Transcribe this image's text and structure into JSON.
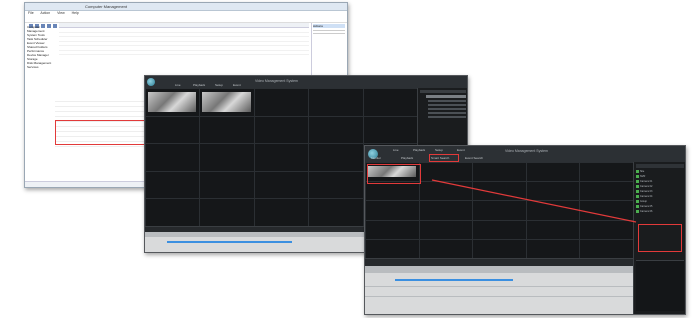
{
  "explorer": {
    "title": "Computer Management",
    "menu": [
      "File",
      "Action",
      "View",
      "Help"
    ],
    "tree_items": [
      "Computer Management",
      "System Tools",
      "Task Scheduler",
      "Event Viewer",
      "Shared Folders",
      "Performance",
      "Device Manager",
      "Storage",
      "Disk Management",
      "Services"
    ],
    "grid_rows": 12,
    "right_panel_title": "Actions"
  },
  "nvr_back": {
    "title": "Video Management System",
    "tabs": [
      "Live",
      "Playback",
      "Setup",
      "Event"
    ],
    "grid_cols": 5,
    "grid_rows": 5
  },
  "nvr_front": {
    "title": "Video Management System",
    "tabs": [
      "Live",
      "Playback",
      "Setup",
      "Event"
    ],
    "subtabs": [
      "Monitor",
      "Playback",
      "Smart Search",
      "Event Search"
    ],
    "grid_cols": 5,
    "grid_rows": 5,
    "right_panel_items": [
      "Site",
      "NVR",
      "Camera 01",
      "Camera 02",
      "Camera 03",
      "Camera 04",
      "Group",
      "Camera 05",
      "Camera 06"
    ]
  },
  "colors": {
    "highlight": "#e23a3a",
    "timeline_bar": "#3b8fe0",
    "accent": "#2a7b92"
  }
}
